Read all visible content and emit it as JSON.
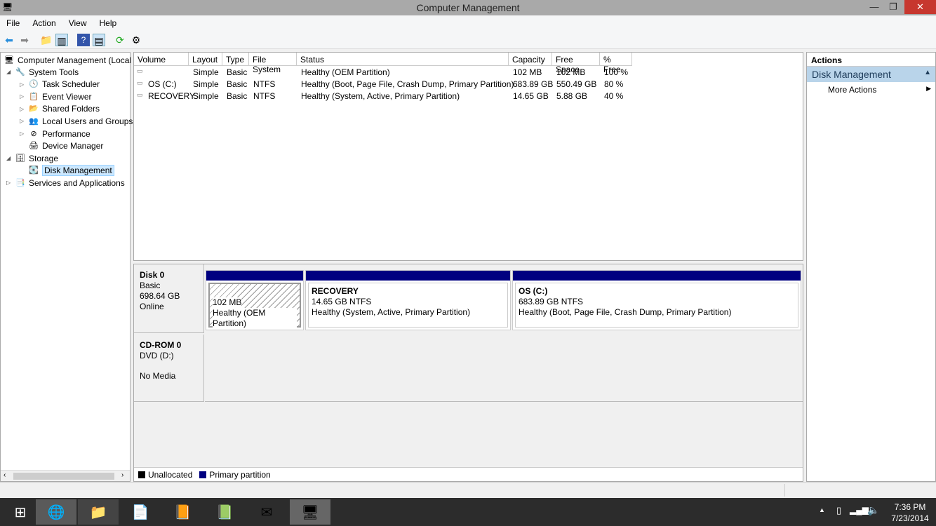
{
  "window": {
    "title": "Computer Management",
    "minimize": "—",
    "restore": "❐",
    "close": "✕"
  },
  "menu": [
    "File",
    "Action",
    "View",
    "Help"
  ],
  "tree": {
    "root": "Computer Management (Local",
    "items": [
      {
        "label": "System Tools",
        "level": 1,
        "expand": "◢"
      },
      {
        "label": "Task Scheduler",
        "level": 2,
        "expand": "▷"
      },
      {
        "label": "Event Viewer",
        "level": 2,
        "expand": "▷"
      },
      {
        "label": "Shared Folders",
        "level": 2,
        "expand": "▷"
      },
      {
        "label": "Local Users and Groups",
        "level": 2,
        "expand": "▷"
      },
      {
        "label": "Performance",
        "level": 2,
        "expand": "▷"
      },
      {
        "label": "Device Manager",
        "level": 2,
        "expand": ""
      },
      {
        "label": "Storage",
        "level": 1,
        "expand": "◢"
      },
      {
        "label": "Disk Management",
        "level": 2,
        "expand": "",
        "selected": true
      },
      {
        "label": "Services and Applications",
        "level": 1,
        "expand": "▷"
      }
    ]
  },
  "volumes": {
    "columns": [
      "Volume",
      "Layout",
      "Type",
      "File System",
      "Status",
      "Capacity",
      "Free Space",
      "% Free"
    ],
    "rows": [
      [
        "",
        "Simple",
        "Basic",
        "",
        "Healthy (OEM Partition)",
        "102 MB",
        "102 MB",
        "100 %"
      ],
      [
        "OS (C:)",
        "Simple",
        "Basic",
        "NTFS",
        "Healthy (Boot, Page File, Crash Dump, Primary Partition)",
        "683.89 GB",
        "550.49 GB",
        "80 %"
      ],
      [
        "RECOVERY",
        "Simple",
        "Basic",
        "NTFS",
        "Healthy (System, Active, Primary Partition)",
        "14.65 GB",
        "5.88 GB",
        "40 %"
      ]
    ]
  },
  "disks": [
    {
      "name": "Disk 0",
      "type": "Basic",
      "size": "698.64 GB",
      "state": "Online",
      "partitions": [
        {
          "title": "",
          "size": "102 MB",
          "status": "Healthy (OEM Partition)"
        },
        {
          "title": "RECOVERY",
          "size": "14.65 GB NTFS",
          "status": "Healthy (System, Active, Primary Partition)"
        },
        {
          "title": "OS  (C:)",
          "size": "683.89 GB NTFS",
          "status": "Healthy (Boot, Page File, Crash Dump, Primary Partition)"
        }
      ]
    },
    {
      "name": "CD-ROM 0",
      "type": "DVD (D:)",
      "state": "No Media"
    }
  ],
  "legend": {
    "unallocated": "Unallocated",
    "primary": "Primary partition",
    "unallocated_color": "#000000",
    "primary_color": "#000080"
  },
  "actions": {
    "header": "Actions",
    "section": "Disk Management",
    "more": "More Actions"
  },
  "taskbar": {
    "time": "7:36 PM",
    "date": "7/23/2014"
  }
}
